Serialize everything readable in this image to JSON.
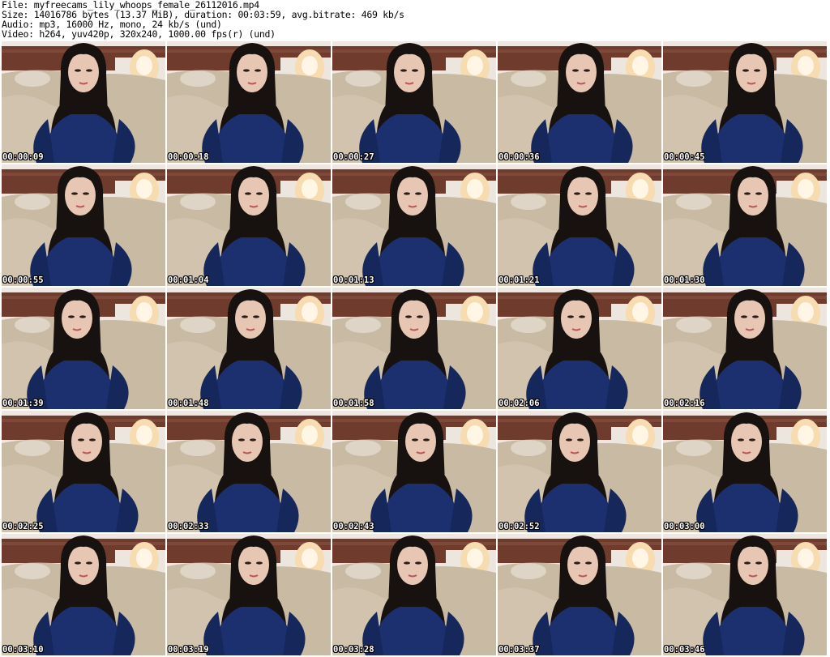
{
  "header": {
    "lines": [
      "File: myfreecams_lily_whoops_female_26112016.mp4",
      "Size: 14016786 bytes (13.37 MiB), duration: 00:03:59, avg.bitrate: 469 kb/s",
      "Audio: mp3, 16000 Hz, mono, 24 kb/s (und)",
      "Video: h264, yuv420p, 320x240, 1000.00 fps(r) (und)"
    ]
  },
  "thumbnails": {
    "subject": "woman-in-blue-sweater-on-bed",
    "colors": {
      "wall": "#efe6df",
      "headboard": "#6e3b2c",
      "bedding": "#c9baa4",
      "sweater": "#1c2f6e",
      "hair": "#17120f",
      "skin": "#e7c6b3",
      "lamp": "#f6dcb0",
      "nightstand": "#ece6df"
    },
    "timestamps": [
      "00:00:09",
      "00:00:18",
      "00:00:27",
      "00:00:36",
      "00:00:45",
      "00:00:55",
      "00:01:04",
      "00:01:13",
      "00:01:21",
      "00:01:30",
      "00:01:39",
      "00:01:48",
      "00:01:58",
      "00:02:06",
      "00:02:16",
      "00:02:25",
      "00:02:33",
      "00:02:43",
      "00:02:52",
      "00:03:00",
      "00:03:10",
      "00:03:19",
      "00:03:28",
      "00:03:37",
      "00:03:46"
    ]
  }
}
